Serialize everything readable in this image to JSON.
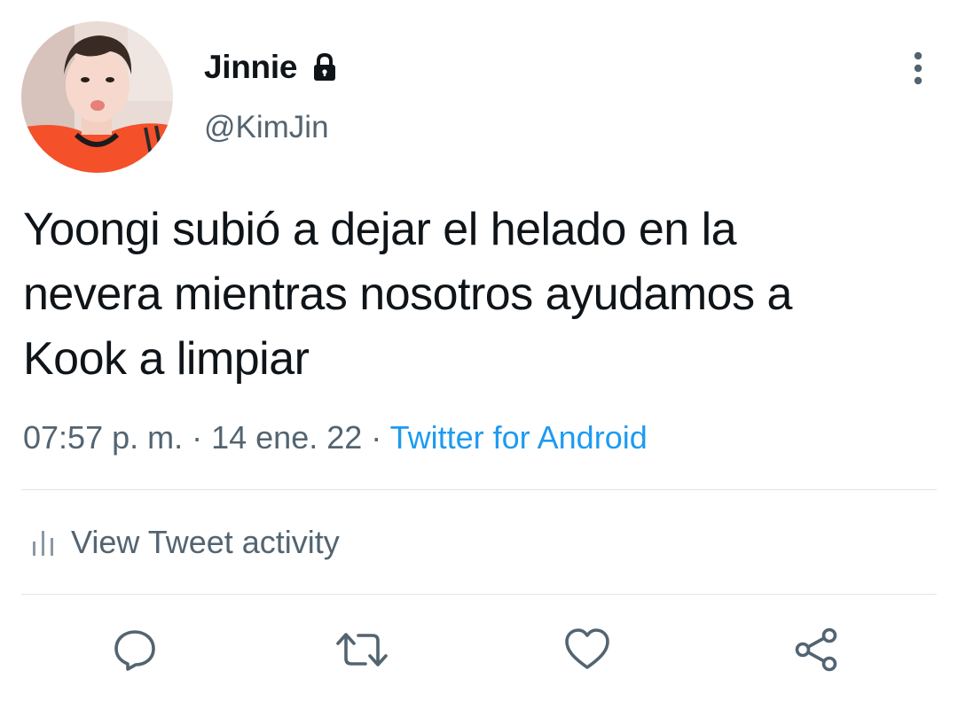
{
  "user": {
    "display_name": "Jinnie",
    "handle": "@KimJin",
    "avatar_icon": "profile-photo-avatar",
    "protected_icon": "lock-icon"
  },
  "tweet": {
    "text": "Yoongi subió a dejar el helado en la\nnevera mientras nosotros ayudamos a\nKook a limpiar",
    "time": "07:57 p. m.",
    "date": "14 ene. 22",
    "separator": " · ",
    "source": "Twitter for Android"
  },
  "activity": {
    "label": "View Tweet activity",
    "icon": "bar-chart-icon"
  },
  "actions": [
    {
      "name": "reply",
      "icon": "reply-icon"
    },
    {
      "name": "retweet",
      "icon": "retweet-icon"
    },
    {
      "name": "like",
      "icon": "heart-icon"
    },
    {
      "name": "share",
      "icon": "share-icon"
    }
  ],
  "colors": {
    "text_primary": "#0f1419",
    "text_secondary": "#536471",
    "link": "#1d9bf0",
    "divider": "#e1e5e8",
    "icon": "#536471"
  }
}
